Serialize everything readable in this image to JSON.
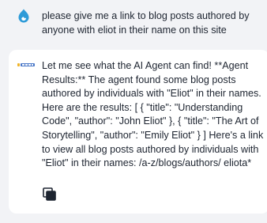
{
  "user_message": {
    "text": "please give me a link to blog posts authored by anyone with eliot in their name on this site",
    "icon": "drupal-drop-icon",
    "icon_color": "#2e9bd8"
  },
  "agent_message": {
    "logo_label": "ai agent logo",
    "text": "Let me see what the AI Agent can find! **Agent Results:** The agent found some blog posts authored by individuals with \"Eliot\" in their names. Here are the results: [ { \"title\": \"Understanding Code\", \"author\": \"John Eliot\" }, { \"title\": \"The Art of Storytelling\", \"author\": \"Emily Eliot\" } ] Here's a link to view all blog posts authored by individuals with \"Eliot\" in their names: /a-z/blogs/authors/ eliota*",
    "copy_icon": "copy-icon"
  },
  "colors": {
    "background": "#f2f3f6",
    "card": "#ffffff",
    "text": "#1d2430",
    "accent": "#2e9bd8"
  }
}
